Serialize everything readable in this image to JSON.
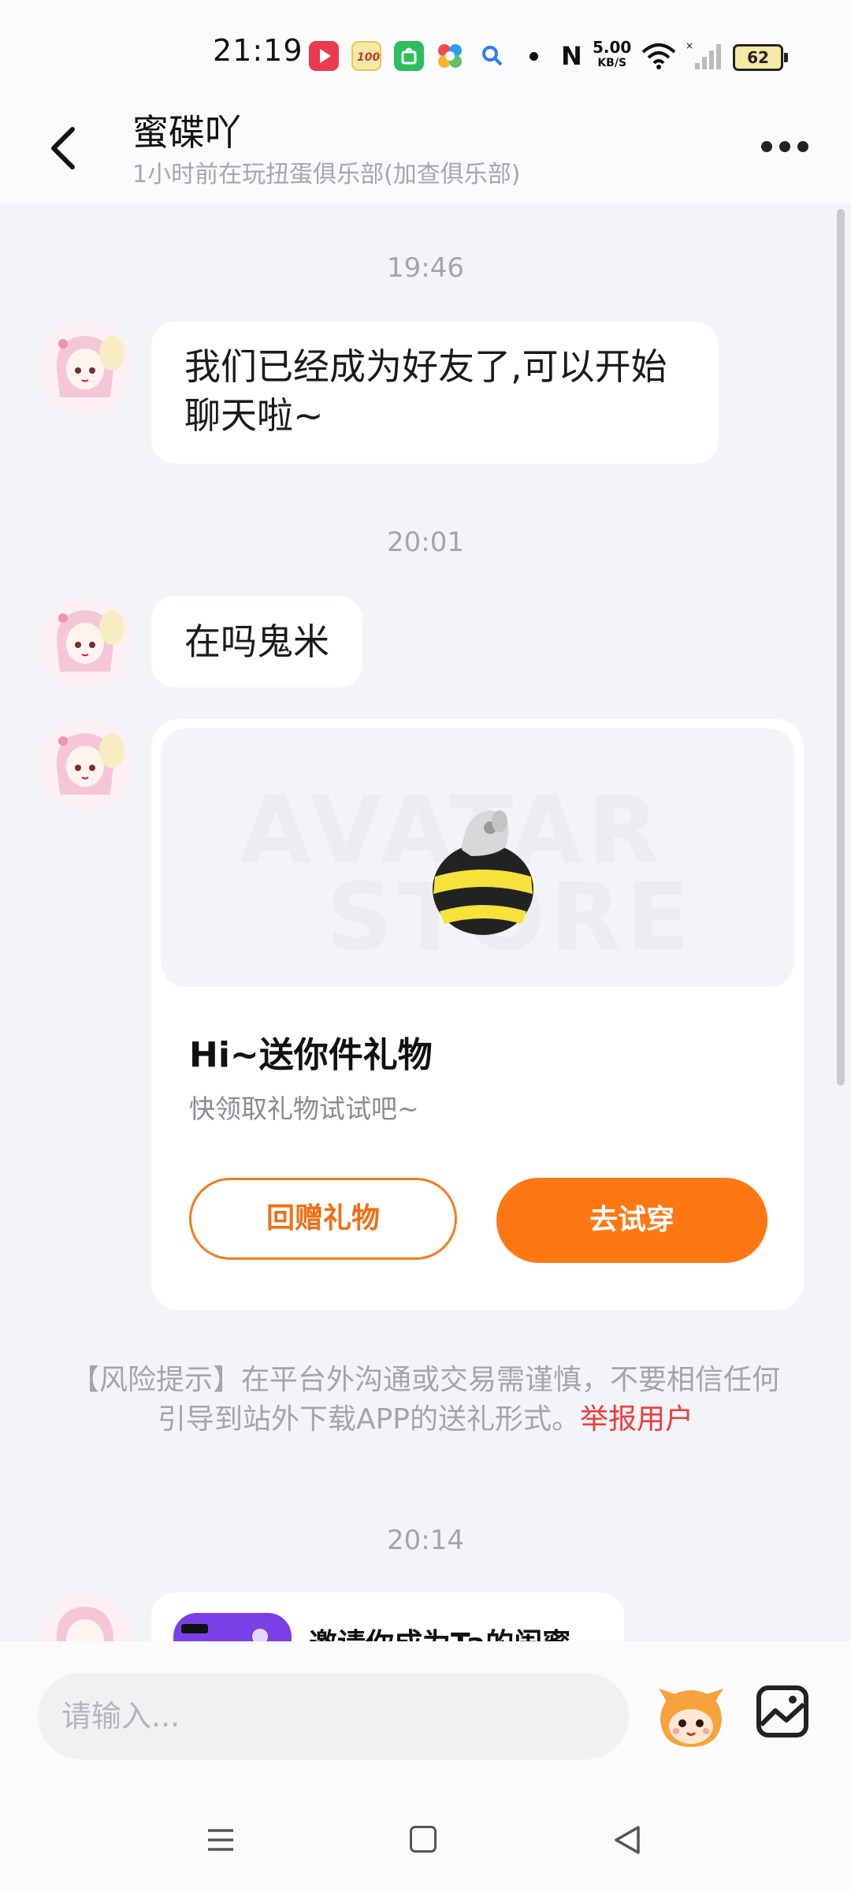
{
  "status_bar": {
    "time": "21:19",
    "net_speed_value": "5.00",
    "net_speed_unit": "KB/S",
    "battery": "62"
  },
  "header": {
    "title": "蜜碟吖",
    "subtitle": "1小时前在玩扭蛋俱乐部(加查俱乐部)"
  },
  "messages": {
    "ts1": "19:46",
    "msg1_line1": "我们已经成为好友了,可以开始",
    "msg1_line2": "聊天啦~",
    "ts2": "20:01",
    "msg2": "在吗鬼米",
    "gift_card": {
      "watermark_line1": "AVATAR",
      "watermark_line2": "STORE",
      "title": "Hi~送你件礼物",
      "subtitle": "快领取礼物试试吧~",
      "return_gift_label": "回赠礼物",
      "try_on_label": "去试穿"
    },
    "risk_line1": "【风险提示】在平台外沟通或交易需谨慎，不要相信任何",
    "risk_line2": "引导到站外下载APP的送礼形式。",
    "risk_report": "举报用户",
    "ts3": "20:14",
    "invite_text": "邀请你成为Ta的闺蜜"
  },
  "input": {
    "placeholder": "请输入..."
  },
  "colors": {
    "accent": "#ff7713",
    "report": "#ef3b3b",
    "background": "#f3f4f8"
  }
}
